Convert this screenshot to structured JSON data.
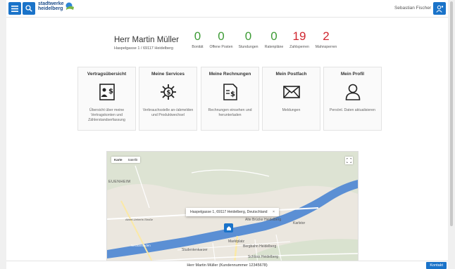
{
  "header": {
    "logo_line1": "stadtwerke",
    "logo_line2": "heidelberg",
    "user_name": "Sebastian Fischer"
  },
  "customer": {
    "name": "Herr Martin Müller",
    "address": "Haspelgasse 1 / 69117 Heidelberg"
  },
  "stats": [
    {
      "value": "0",
      "label": "Bonität",
      "color": "#3d9b35"
    },
    {
      "value": "0",
      "label": "Offene Posten",
      "color": "#3d9b35"
    },
    {
      "value": "0",
      "label": "Stundungen",
      "color": "#3d9b35"
    },
    {
      "value": "0",
      "label": "Ratenpläne",
      "color": "#3d9b35"
    },
    {
      "value": "19",
      "label": "Zahlsperren",
      "color": "#d0262f"
    },
    {
      "value": "2",
      "label": "Mahnsperren",
      "color": "#d0262f"
    }
  ],
  "cards": [
    {
      "title": "Vertragsübersicht",
      "icon": "contract-icon",
      "desc": "Übersicht über meine Vertragskonten und Zählerstandserfassung"
    },
    {
      "title": "Meine Services",
      "icon": "services-gear-icon",
      "desc": "Verbrauchsstelle an-/abmelden und Produktwechsel"
    },
    {
      "title": "Meine Rechnungen",
      "icon": "invoice-icon",
      "desc": "Rechnungen einsehen und herunterladen"
    },
    {
      "title": "Mein Postfach",
      "icon": "envelope-icon",
      "desc": "Meldungen"
    },
    {
      "title": "Mein Profil",
      "icon": "user-icon",
      "desc": "Persönl. Daten aktualisieren"
    }
  ],
  "map": {
    "toggle_map": "Karte",
    "toggle_sat": "Satellit",
    "info_text": "Haspelgasse 1, 69117 Heidelberg, Deutschland",
    "close": "×",
    "labels": {
      "neuenheim": "EUENHEIM",
      "bridge": "Alte Brücke Heidelberg",
      "karlstor": "Karlstor",
      "marktplatz": "Marktplatz",
      "bergbahn": "Bergbahn Heidelberg",
      "schloss": "Schloss Heidelberg",
      "studentenkarzer": "Studentenkarzer",
      "neckarstaden": "Neckarstaden",
      "albert": "Albert-Ueberle-Straße"
    }
  },
  "footer": {
    "customer_text": "Herr Martin Müller (Kundennummer 12345678)",
    "contact_label": "Kontakt"
  },
  "colors": {
    "accent": "#1a73c9",
    "green": "#3d9b35",
    "red": "#d0262f"
  }
}
